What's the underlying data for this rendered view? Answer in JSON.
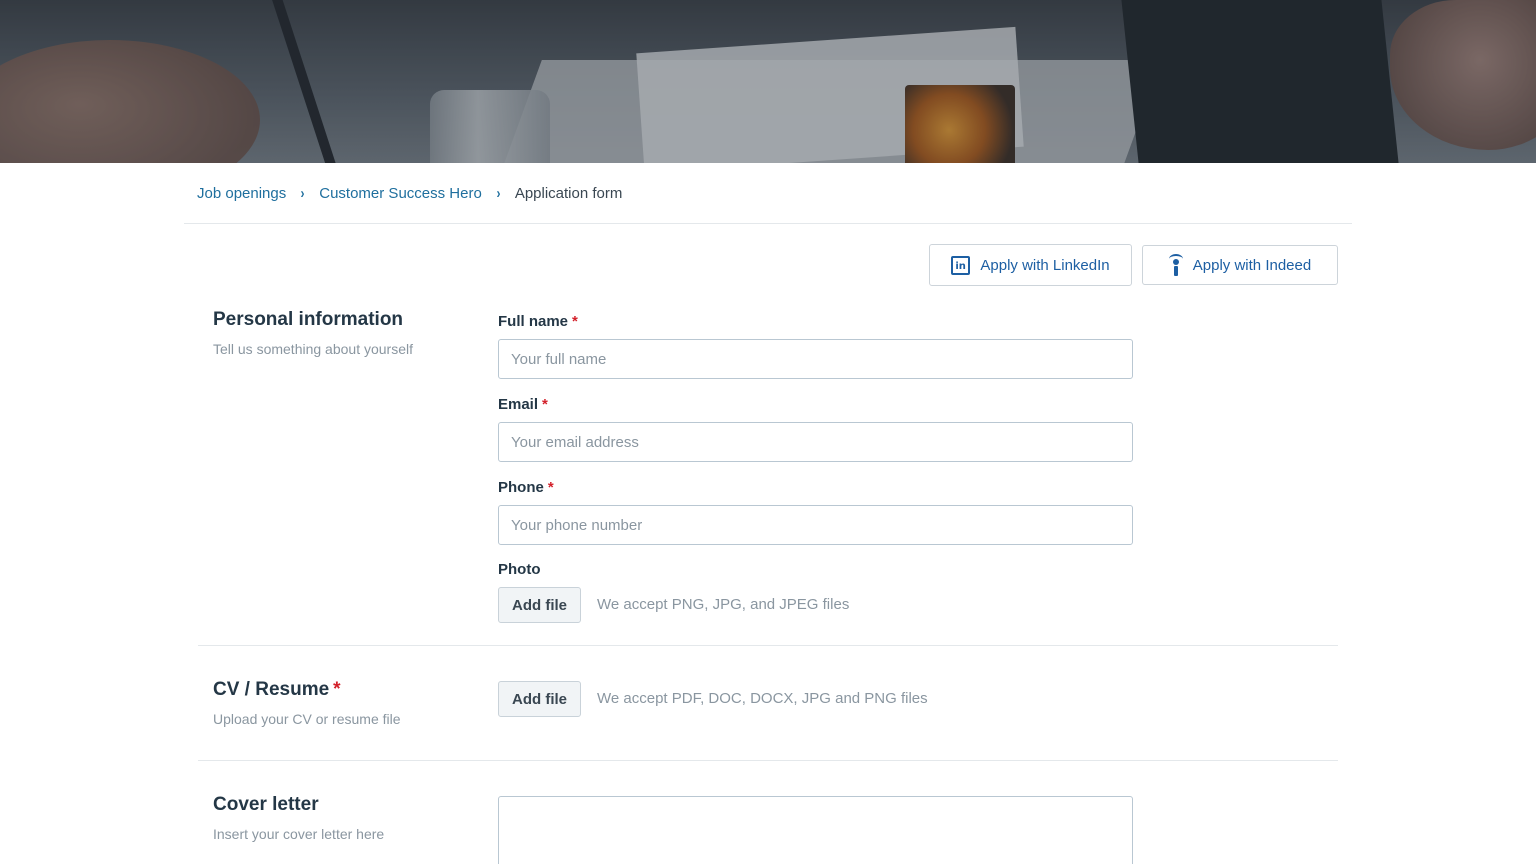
{
  "breadcrumb": {
    "items": [
      "Job openings",
      "Customer Success Hero"
    ],
    "current": "Application form"
  },
  "apply": {
    "linkedin_label": "Apply with LinkedIn",
    "indeed_label": "Apply with Indeed"
  },
  "personal": {
    "title": "Personal information",
    "subtitle": "Tell us something about yourself",
    "full_name_label": "Full name",
    "full_name_placeholder": "Your full name",
    "email_label": "Email",
    "email_placeholder": "Your email address",
    "phone_label": "Phone",
    "phone_placeholder": "Your phone number",
    "photo_label": "Photo",
    "photo_button": "Add file",
    "photo_hint": "We accept PNG, JPG, and JPEG files"
  },
  "cv": {
    "title": "CV / Resume",
    "subtitle": "Upload your CV or resume file",
    "button": "Add file",
    "hint": "We accept PDF, DOC, DOCX, JPG and PNG files"
  },
  "cover": {
    "title": "Cover letter",
    "subtitle": "Insert your cover letter here"
  },
  "required_marker": "*",
  "breadcrumb_separator": "›",
  "colors": {
    "link": "#1f6f9e",
    "accent": "#1d5fa3",
    "required": "#d3202a",
    "text": "#243746",
    "muted": "#8a96a0"
  },
  "icons": {
    "linkedin": "linkedin-icon",
    "indeed": "indeed-icon",
    "separator": "chevron-right-icon"
  }
}
